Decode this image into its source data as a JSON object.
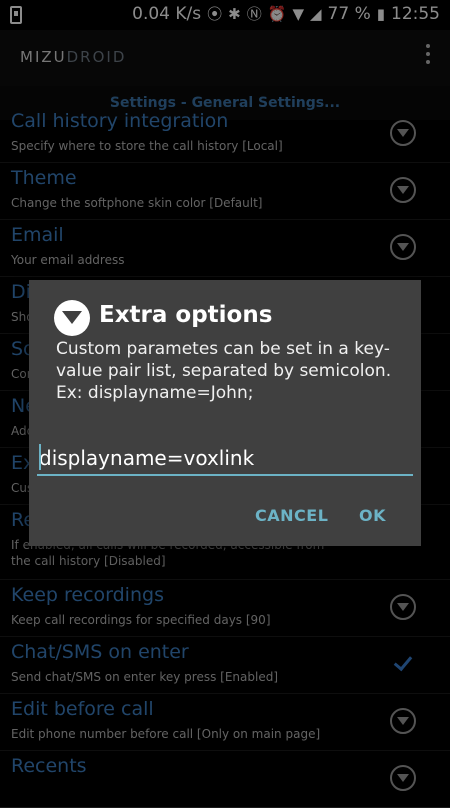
{
  "status_bar": {
    "net_speed": "0.04 K/s",
    "battery": "77 %",
    "time": "12:55"
  },
  "app_bar": {
    "logo_part1": "MIZU",
    "logo_part2": "DROID"
  },
  "header": {
    "title": "Settings - General Settings..."
  },
  "settings": [
    {
      "title": "Call history integration",
      "summary": "Specify where to store the call history [Local]",
      "control": "chevron"
    },
    {
      "title": "Theme",
      "summary": "Change the softphone skin color [Default]",
      "control": "chevron"
    },
    {
      "title": "Email",
      "summary": "Your email address",
      "control": "chevron"
    },
    {
      "title": "Di",
      "summary": "Sho",
      "control": "chevron"
    },
    {
      "title": "So",
      "summary": "Con",
      "control": "chevron"
    },
    {
      "title": "Ne",
      "summary": "Add",
      "control": "chevron"
    },
    {
      "title": "Ex",
      "summary": "Cus",
      "control": "chevron"
    },
    {
      "title": "Re",
      "summary": "If enabled, all calls will be recorded, accessible from the call history [Disabled]",
      "control": "none"
    },
    {
      "title": "Keep recordings",
      "summary": "Keep call recordings for specified days [90]",
      "control": "chevron"
    },
    {
      "title": "Chat/SMS on enter",
      "summary": "Send chat/SMS on enter key press [Enabled]",
      "control": "checkbox"
    },
    {
      "title": "Edit before call",
      "summary": "Edit phone number before call [Only on main page]",
      "control": "chevron"
    },
    {
      "title": "Recents",
      "summary": "",
      "control": "chevron"
    }
  ],
  "dialog": {
    "title": "Extra options",
    "message": "Custom parametes can be set in a key-value pair list, separated by semicolon.",
    "example": "Ex: displayname=John;",
    "input_value": "displayname=voxlink",
    "cancel_label": "CANCEL",
    "ok_label": "OK"
  },
  "colors": {
    "accent": "#6cb3c6",
    "title_blue": "#3d7fc1",
    "dialog_bg": "#404040"
  }
}
